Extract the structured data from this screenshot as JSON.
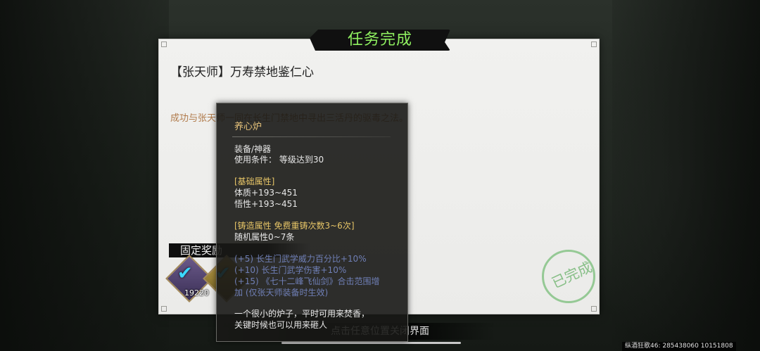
{
  "quest": {
    "header": "任务完成",
    "name": "【张天师】万寿禁地鉴仁心",
    "description": "成功与张天师一同在长生门禁地中寻出三活丹的驱毒之法。"
  },
  "rewards": {
    "label": "固定奖励",
    "items": [
      {
        "icon": "equipment-icon",
        "count": "19220",
        "checked": true
      },
      {
        "icon": "gold-item-icon",
        "count": "",
        "checked": true
      }
    ]
  },
  "stamp": "已完成",
  "hint": "点击任意位置关闭界面",
  "tooltip": {
    "title": "养心炉",
    "category": "装备/神器",
    "requirement": "使用条件：  等级达到30",
    "base_header": "[基础属性]",
    "base_attrs": [
      "体质+193~451",
      "悟性+193~451"
    ],
    "forge_header": "[铸造属性  免费重铸次数3~6次]",
    "forge_desc": "随机属性0~7条",
    "bonus_lines": [
      "(+5) 长生门武学威力百分比+10%",
      "(+10) 长生门武学伤害+10%",
      "(+15) 《七十二峰飞仙剑》合击范围增",
      "加 (仅张天师装备时生效)"
    ],
    "flavor": [
      "一个很小的炉子，平时可用来焚香，",
      "关键时候也可以用来砸人"
    ]
  },
  "footer": "纵酒狂歌46: 285438060  10151808",
  "colors": {
    "header_text": "#8ff060",
    "gold": "#e7c567",
    "inactive_bonus": "#6f7fb6",
    "description": "#b07a4a"
  }
}
